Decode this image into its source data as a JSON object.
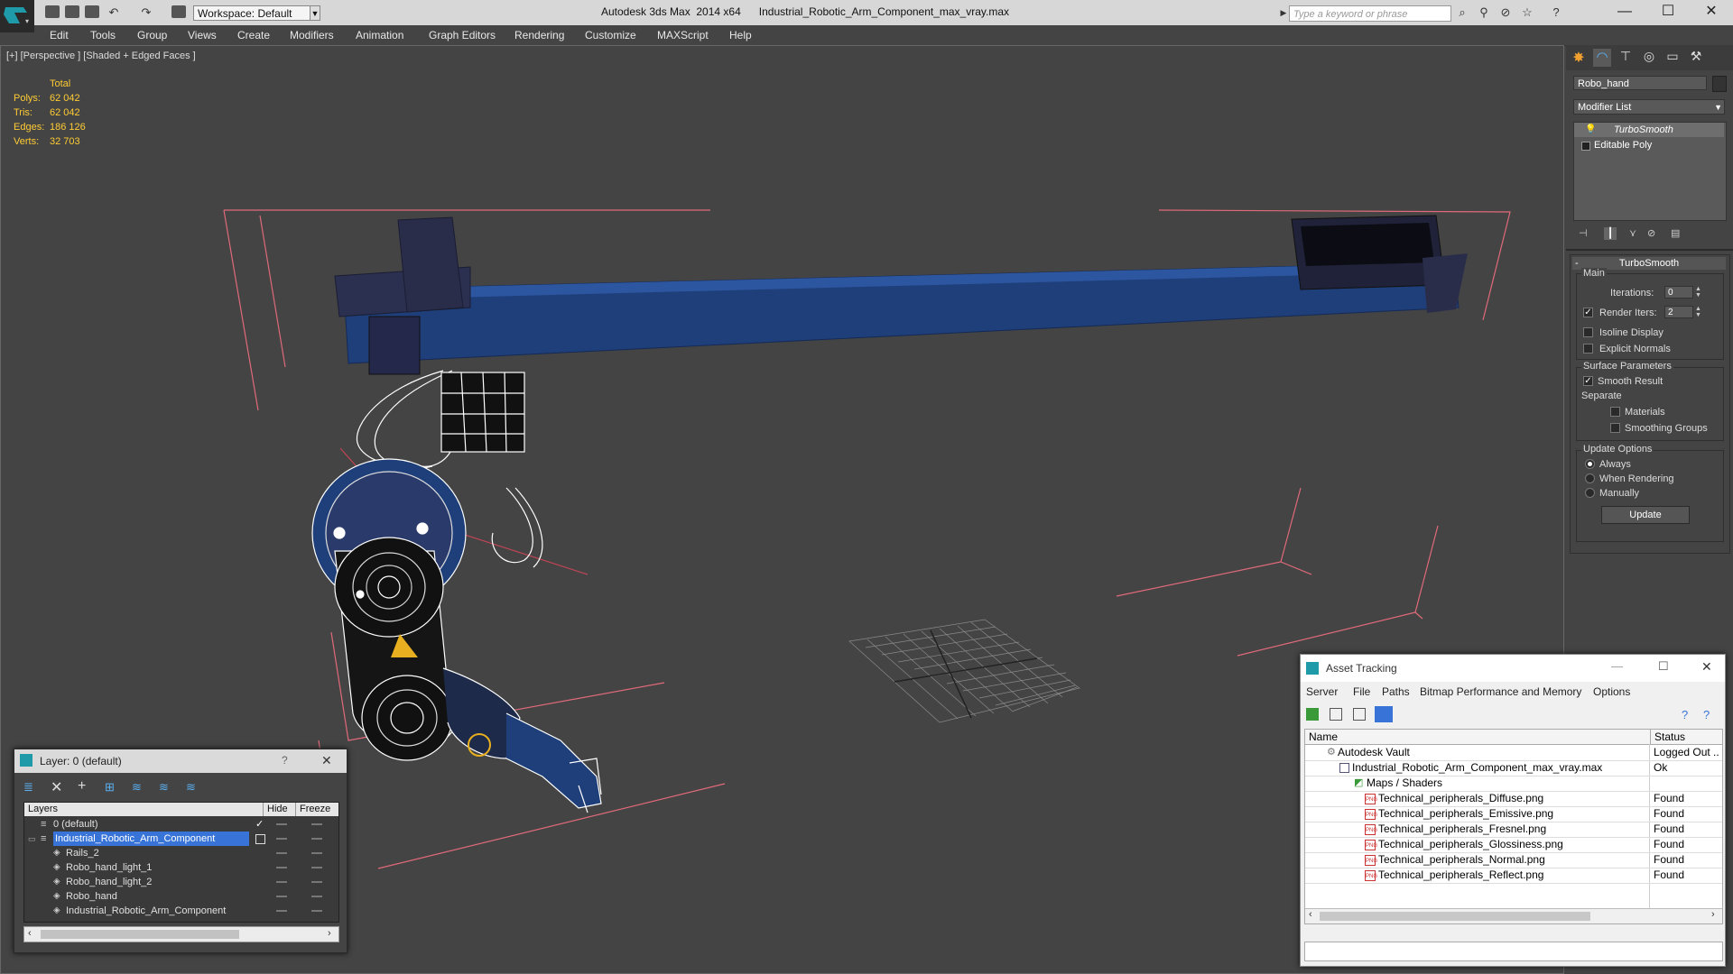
{
  "titlebar": {
    "app_title": "Autodesk 3ds Max  2014 x64",
    "file_title": "Industrial_Robotic_Arm_Component_max_vray.max",
    "workspace": "Workspace: Default",
    "search_placeholder": "Type a keyword or phrase",
    "minimize": "—",
    "maximize": "☐",
    "close": "✕"
  },
  "menubar": [
    "Edit",
    "Tools",
    "Group",
    "Views",
    "Create",
    "Modifiers",
    "Animation",
    "Graph Editors",
    "Rendering",
    "Customize",
    "MAXScript",
    "Help"
  ],
  "viewport": {
    "label": "[+] [Perspective ] [Shaded + Edged Faces ]",
    "stats": {
      "header": "Total",
      "polys_label": "Polys:",
      "polys": "62 042",
      "tris_label": "Tris:",
      "tris": "62 042",
      "edges_label": "Edges:",
      "edges": "186 126",
      "verts_label": "Verts:",
      "verts": "32 703"
    }
  },
  "command_panel": {
    "object_name": "Robo_hand",
    "modifier_list": "Modifier List",
    "stack": [
      "TurboSmooth",
      "Editable Poly"
    ],
    "rollout_title": "TurboSmooth",
    "main_group": "Main",
    "iterations_label": "Iterations:",
    "iterations_value": "0",
    "render_iters_label": "Render Iters:",
    "render_iters_value": "2",
    "render_iters_checked": true,
    "isoline_label": "Isoline Display",
    "explicit_normals_label": "Explicit Normals",
    "surface_group": "Surface Parameters",
    "smooth_result_label": "Smooth Result",
    "separate_label": "Separate",
    "materials_label": "Materials",
    "smoothing_groups_label": "Smoothing Groups",
    "update_group": "Update Options",
    "always_label": "Always",
    "when_rendering_label": "When Rendering",
    "manually_label": "Manually",
    "update_button": "Update"
  },
  "layer_dialog": {
    "title": "Layer: 0 (default)",
    "help": "?",
    "close": "✕",
    "col_layers": "Layers",
    "col_hide": "Hide",
    "col_freeze": "Freeze",
    "rows": [
      {
        "name": "0 (default)",
        "indent": 0
      },
      {
        "name": "Industrial_Robotic_Arm_Component",
        "indent": 0
      },
      {
        "name": "Rails_2",
        "indent": 1
      },
      {
        "name": "Robo_hand_light_1",
        "indent": 1
      },
      {
        "name": "Robo_hand_light_2",
        "indent": 1
      },
      {
        "name": "Robo_hand",
        "indent": 1
      },
      {
        "name": "Industrial_Robotic_Arm_Component",
        "indent": 1
      }
    ]
  },
  "asset_tracking": {
    "title": "Asset Tracking",
    "menu": [
      "Server",
      "File",
      "Paths",
      "Bitmap Performance and Memory",
      "Options"
    ],
    "col_name": "Name",
    "col_status": "Status",
    "rows": [
      {
        "name": "Autodesk Vault",
        "status": "Logged Out ..",
        "icon": "vault"
      },
      {
        "name": "Industrial_Robotic_Arm_Component_max_vray.max",
        "status": "Ok",
        "icon": "max"
      },
      {
        "name": "Maps / Shaders",
        "status": "",
        "icon": "maps"
      },
      {
        "name": "Technical_peripherals_Diffuse.png",
        "status": "Found",
        "icon": "png"
      },
      {
        "name": "Technical_peripherals_Emissive.png",
        "status": "Found",
        "icon": "png"
      },
      {
        "name": "Technical_peripherals_Fresnel.png",
        "status": "Found",
        "icon": "png"
      },
      {
        "name": "Technical_peripherals_Glossiness.png",
        "status": "Found",
        "icon": "png"
      },
      {
        "name": "Technical_peripherals_Normal.png",
        "status": "Found",
        "icon": "png"
      },
      {
        "name": "Technical_peripherals_Reflect.png",
        "status": "Found",
        "icon": "png"
      }
    ],
    "png_badge": "PNG",
    "minimize": "—",
    "maximize": "☐",
    "close": "✕"
  },
  "colors": {
    "accent": "#3874d8",
    "stats_yellow": "#ffcc33",
    "bounding_box": "#e06a7a",
    "rail_blue": "#1e3f7a"
  }
}
